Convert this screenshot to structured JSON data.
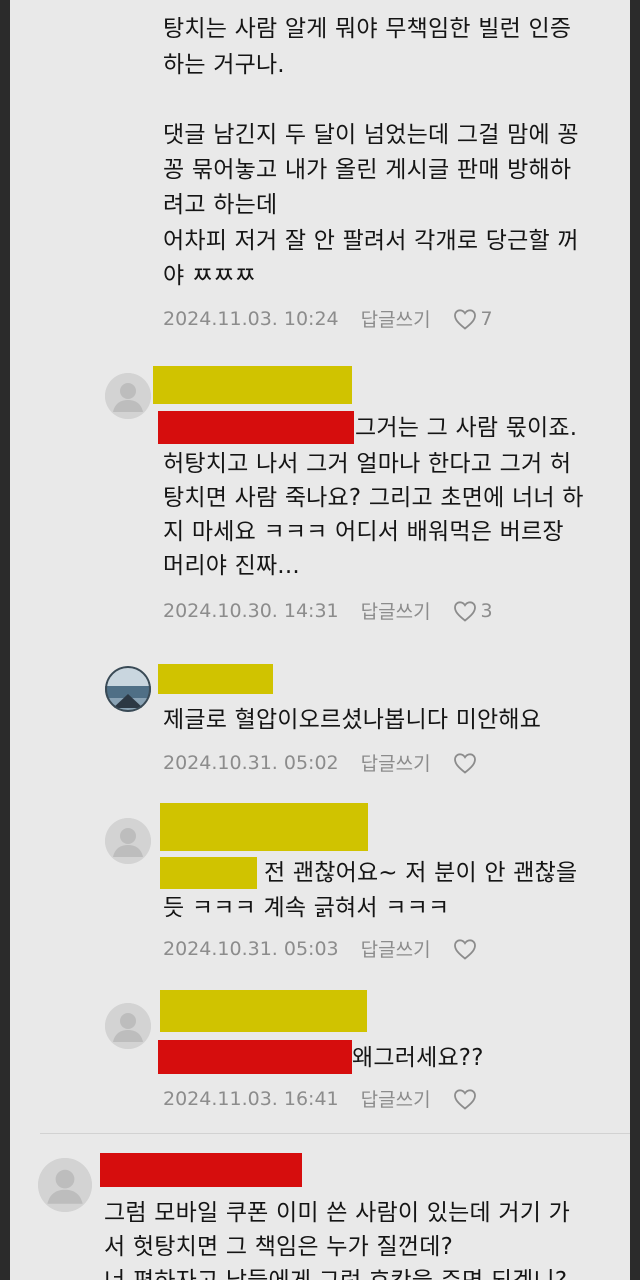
{
  "comment_main": {
    "text_lines": [
      "탕치는 사람 알게 뭐야 무책임한 빌런 인증",
      "하는 거구나.",
      "",
      "댓글 남긴지 두 달이 넘었는데 그걸 맘에 꽁",
      "꽁 묶어놓고 내가 올린 게시글 판매 방해하",
      "려고 하는데",
      "어차피 저거 잘 안 팔려서 각개로 당근할 꺼",
      "야 ㅉㅉㅉ"
    ],
    "date": "2024.11.03. 10:24",
    "reply_label": "답글쓰기",
    "likes": "7"
  },
  "replies": [
    {
      "text_first": "그거는 그 사람 몫이죠.",
      "text_rest": "허탕치고 나서 그거 얼마나 한다고 그거 허\n탕치면 사람 죽나요? 그리고 초면에 너너 하\n지 마세요 ㅋㅋㅋ 어디서 배워먹은 버르장\n머리야 진짜...",
      "date": "2024.10.30. 14:31",
      "reply_label": "답글쓰기",
      "likes": "3"
    },
    {
      "text": "제글로 혈압이오르셨나봅니다 미안해요",
      "date": "2024.10.31. 05:02",
      "reply_label": "답글쓰기",
      "likes": ""
    },
    {
      "text_first": "전 괜찮어요~ 저 분이 안 괜찮을",
      "text_rest": "듯 ㅋㅋㅋ 계속 긁혀서 ㅋㅋㅋ",
      "date": "2024.10.31. 05:03",
      "reply_label": "답글쓰기",
      "likes": ""
    },
    {
      "text_first": "왜그러세요??",
      "date": "2024.11.03. 16:41",
      "reply_label": "답글쓰기",
      "likes": ""
    }
  ],
  "comment_next": {
    "text": "그럼 모바일 쿠폰 이미 쓴 사람이 있는데 거기 가\n서 헛탕치면 그 책임은 누가 질껀데?\n너 편하자고 남들에게 그런 호칸을 주면 되겠니?"
  },
  "colors": {
    "censor_yellow": "#d0c300",
    "censor_red": "#d60d0d",
    "background": "#e9e9e9",
    "meta_gray": "#8c8c8c"
  },
  "icons": {
    "like": "heart-outline-icon",
    "avatar": "default-user-avatar-icon"
  }
}
